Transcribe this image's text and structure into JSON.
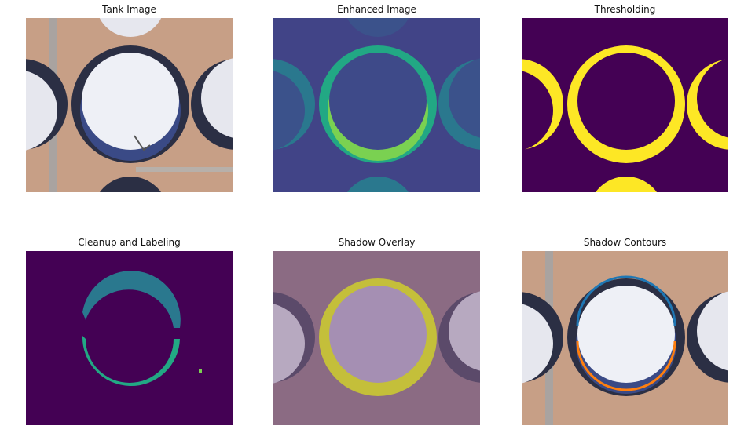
{
  "panels": [
    {
      "title": "Tank Image"
    },
    {
      "title": "Enhanced Image"
    },
    {
      "title": "Thresholding"
    },
    {
      "title": "Cleanup and Labeling"
    },
    {
      "title": "Shadow Overlay"
    },
    {
      "title": "Shadow Contours"
    }
  ],
  "colors": {
    "viridis_dark": "#440154",
    "viridis_teal": "#2a788e",
    "viridis_green": "#22a884",
    "viridis_yellow": "#fde725",
    "ground": "#c9a58e",
    "tank_roof": "#e8eaf0",
    "shadow": "#2b2f44",
    "contour_blue": "#1f77b4",
    "contour_orange": "#ff7f0e"
  }
}
